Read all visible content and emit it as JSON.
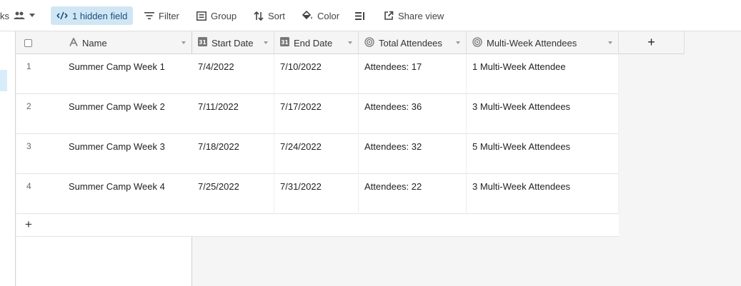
{
  "toolbar": {
    "view_fragment": "ks",
    "hidden_fields": "1 hidden field",
    "filter": "Filter",
    "group": "Group",
    "sort": "Sort",
    "color": "Color",
    "share_view": "Share view"
  },
  "columns": {
    "name": "Name",
    "start_date": "Start Date",
    "end_date": "End Date",
    "total_attendees": "Total Attendees",
    "multi_week_attendees": "Multi-Week Attendees"
  },
  "add_column_label": "+",
  "add_row_label": "+",
  "rows": [
    {
      "num": "1",
      "name": "Summer Camp Week 1",
      "start": "7/4/2022",
      "end": "7/10/2022",
      "total": "Attendees: 17",
      "multi": "1 Multi-Week Attendee"
    },
    {
      "num": "2",
      "name": "Summer Camp Week 2",
      "start": "7/11/2022",
      "end": "7/17/2022",
      "total": "Attendees: 36",
      "multi": "3 Multi-Week Attendees"
    },
    {
      "num": "3",
      "name": "Summer Camp Week 3",
      "start": "7/18/2022",
      "end": "7/24/2022",
      "total": "Attendees: 32",
      "multi": "5 Multi-Week Attendees"
    },
    {
      "num": "4",
      "name": "Summer Camp Week 4",
      "start": "7/25/2022",
      "end": "7/31/2022",
      "total": "Attendees: 22",
      "multi": "3 Multi-Week Attendees"
    }
  ],
  "icons": {
    "people": "people-icon",
    "hidden": "eye-slash-icon",
    "filter": "filter-icon",
    "group": "group-icon",
    "sort": "sort-icon",
    "color": "paint-bucket-icon",
    "row_height": "row-height-icon",
    "share": "share-icon",
    "text_field": "text-field-icon",
    "date_field": "calendar-icon",
    "rollup_field": "rollup-icon"
  },
  "colors": {
    "accent_active": "#d1e6f5",
    "selection": "#d9ecfa"
  }
}
